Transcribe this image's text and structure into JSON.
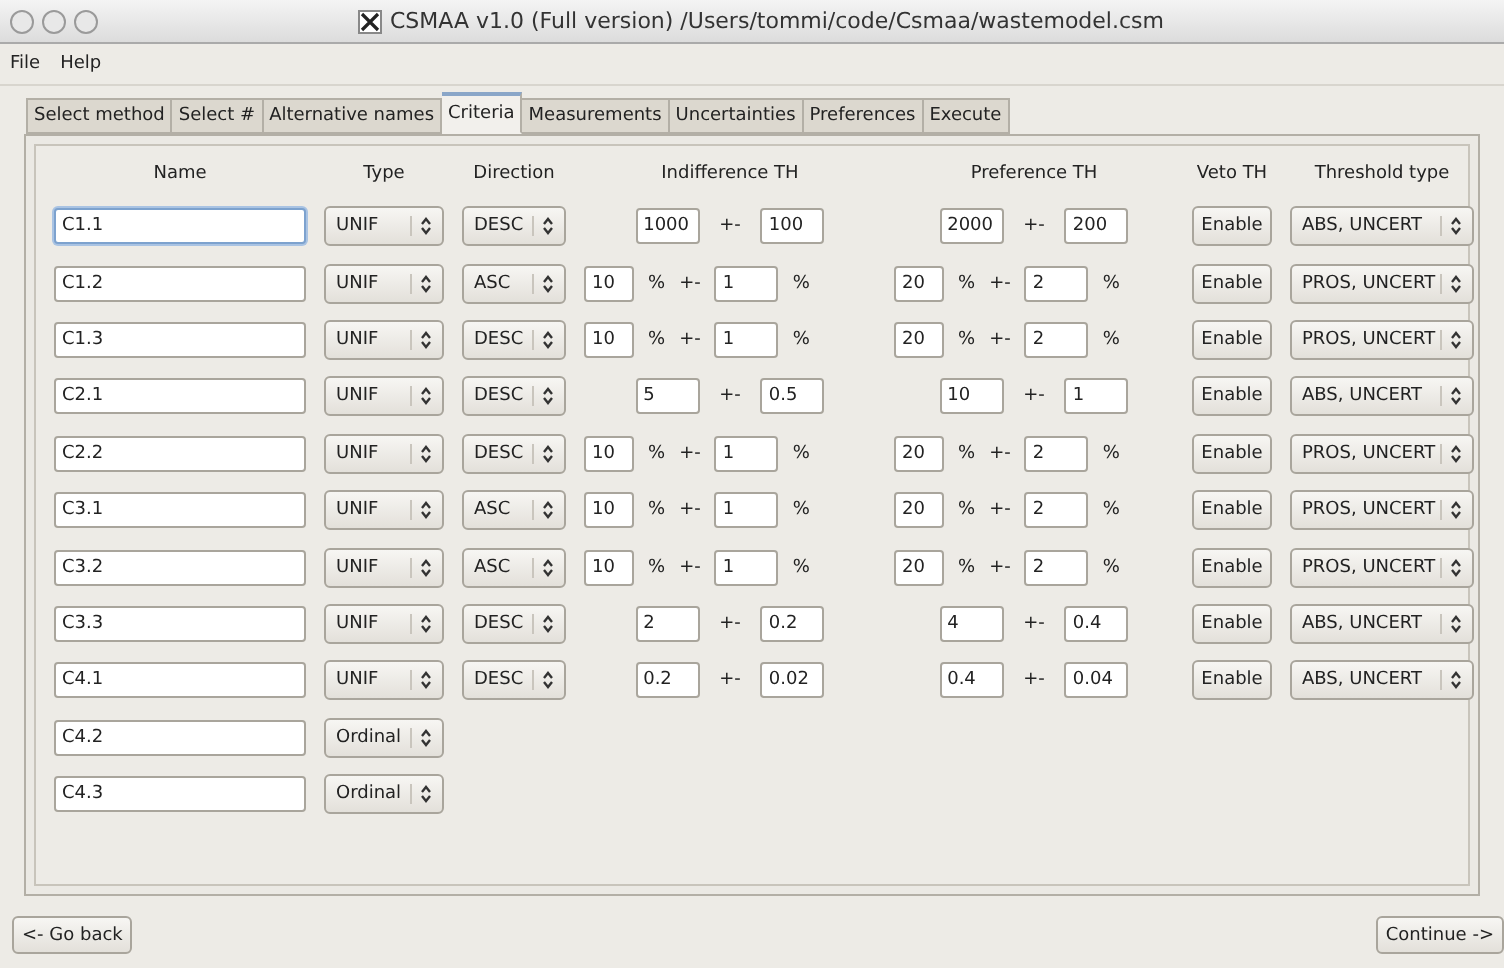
{
  "window": {
    "title": "CSMAA v1.0 (Full version) /Users/tommi/code/Csmaa/wastemodel.csm"
  },
  "menu": [
    "File",
    "Help"
  ],
  "tabs": [
    {
      "label": "Select method",
      "selected": false
    },
    {
      "label": "Select #",
      "selected": false
    },
    {
      "label": "Alternative names",
      "selected": false
    },
    {
      "label": "Criteria",
      "selected": true
    },
    {
      "label": "Measurements",
      "selected": false
    },
    {
      "label": "Uncertainties",
      "selected": false
    },
    {
      "label": "Preferences",
      "selected": false
    },
    {
      "label": "Execute",
      "selected": false
    }
  ],
  "columns": [
    "Name",
    "Type",
    "Direction",
    "Indifference TH",
    "Preference TH",
    "Veto TH",
    "Threshold type"
  ],
  "rows": [
    {
      "kind": "absolute",
      "name": "C1.1",
      "focused": true,
      "type": "UNIF",
      "direction": "DESC",
      "indifference": {
        "value": "1000",
        "sep": "+-",
        "spread": "100"
      },
      "preference": {
        "value": "2000",
        "sep": "+-",
        "spread": "200"
      },
      "veto": "Enable",
      "threshold_type": "ABS, UNCERT"
    },
    {
      "kind": "percent",
      "name": "C1.2",
      "focused": false,
      "type": "UNIF",
      "direction": "ASC",
      "indifference": {
        "value": "10",
        "unit": "%",
        "sep": "+-",
        "spread": "1",
        "spread_unit": "%"
      },
      "preference": {
        "value": "20",
        "unit": "%",
        "sep": "+-",
        "spread": "2",
        "spread_unit": "%"
      },
      "veto": "Enable",
      "threshold_type": "PROS, UNCERT"
    },
    {
      "kind": "percent",
      "name": "C1.3",
      "focused": false,
      "type": "UNIF",
      "direction": "DESC",
      "indifference": {
        "value": "10",
        "unit": "%",
        "sep": "+-",
        "spread": "1",
        "spread_unit": "%"
      },
      "preference": {
        "value": "20",
        "unit": "%",
        "sep": "+-",
        "spread": "2",
        "spread_unit": "%"
      },
      "veto": "Enable",
      "threshold_type": "PROS, UNCERT"
    },
    {
      "kind": "absolute",
      "name": "C2.1",
      "focused": false,
      "type": "UNIF",
      "direction": "DESC",
      "indifference": {
        "value": "5",
        "sep": "+-",
        "spread": "0.5"
      },
      "preference": {
        "value": "10",
        "sep": "+-",
        "spread": "1"
      },
      "veto": "Enable",
      "threshold_type": "ABS, UNCERT"
    },
    {
      "kind": "percent",
      "name": "C2.2",
      "focused": false,
      "type": "UNIF",
      "direction": "DESC",
      "indifference": {
        "value": "10",
        "unit": "%",
        "sep": "+-",
        "spread": "1",
        "spread_unit": "%"
      },
      "preference": {
        "value": "20",
        "unit": "%",
        "sep": "+-",
        "spread": "2",
        "spread_unit": "%"
      },
      "veto": "Enable",
      "threshold_type": "PROS, UNCERT"
    },
    {
      "kind": "percent",
      "name": "C3.1",
      "focused": false,
      "type": "UNIF",
      "direction": "ASC",
      "indifference": {
        "value": "10",
        "unit": "%",
        "sep": "+-",
        "spread": "1",
        "spread_unit": "%"
      },
      "preference": {
        "value": "20",
        "unit": "%",
        "sep": "+-",
        "spread": "2",
        "spread_unit": "%"
      },
      "veto": "Enable",
      "threshold_type": "PROS, UNCERT"
    },
    {
      "kind": "percent",
      "name": "C3.2",
      "focused": false,
      "type": "UNIF",
      "direction": "ASC",
      "indifference": {
        "value": "10",
        "unit": "%",
        "sep": "+-",
        "spread": "1",
        "spread_unit": "%"
      },
      "preference": {
        "value": "20",
        "unit": "%",
        "sep": "+-",
        "spread": "2",
        "spread_unit": "%"
      },
      "veto": "Enable",
      "threshold_type": "PROS, UNCERT"
    },
    {
      "kind": "absolute",
      "name": "C3.3",
      "focused": false,
      "type": "UNIF",
      "direction": "DESC",
      "indifference": {
        "value": "2",
        "sep": "+-",
        "spread": "0.2"
      },
      "preference": {
        "value": "4",
        "sep": "+-",
        "spread": "0.4"
      },
      "veto": "Enable",
      "threshold_type": "ABS, UNCERT"
    },
    {
      "kind": "absolute",
      "name": "C4.1",
      "focused": false,
      "type": "UNIF",
      "direction": "DESC",
      "indifference": {
        "value": "0.2",
        "sep": "+-",
        "spread": "0.02"
      },
      "preference": {
        "value": "0.4",
        "sep": "+-",
        "spread": "0.04"
      },
      "veto": "Enable",
      "threshold_type": "ABS, UNCERT"
    },
    {
      "kind": "ordinal",
      "name": "C4.2",
      "focused": false,
      "type": "Ordinal"
    },
    {
      "kind": "ordinal",
      "name": "C4.3",
      "focused": false,
      "type": "Ordinal"
    }
  ],
  "buttons": {
    "back": "<- Go back",
    "next": "Continue ->"
  }
}
